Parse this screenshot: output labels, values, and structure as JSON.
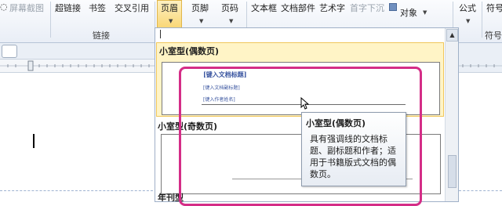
{
  "ribbon": {
    "items": {
      "screenshot": "屏幕截图",
      "hyperlink": "超链接",
      "bookmark": "书签",
      "cross_ref": "交叉引用",
      "header": "页眉",
      "footer": "页脚",
      "page_number": "页码",
      "textbox": "文本框",
      "doc_parts": "文档部件",
      "wordart": "艺术字",
      "dropcap": "首字下沉",
      "object": "对象",
      "equation": "公式",
      "symbol": "符号"
    },
    "groups": {
      "links": "链接",
      "symbols": "符号"
    }
  },
  "gallery": {
    "section1": "小室型(偶数页)",
    "section2": "小室型(奇数页)",
    "section3": "年刊型",
    "preview": {
      "title_ph": "[键入文档标题]",
      "subtitle_ph": "[键入文档副标题]",
      "author_ph": "[键入作者姓名]"
    }
  },
  "tooltip": {
    "title": "小室型(偶数页)",
    "body": "具有强调线的文档标题、副标题和作者；适用于书籍版式文档的偶数页。"
  },
  "colors": {
    "highlight": "#d42d87",
    "hover_fill": "#fff4c6",
    "placeholder_text": "#3a55a0"
  }
}
